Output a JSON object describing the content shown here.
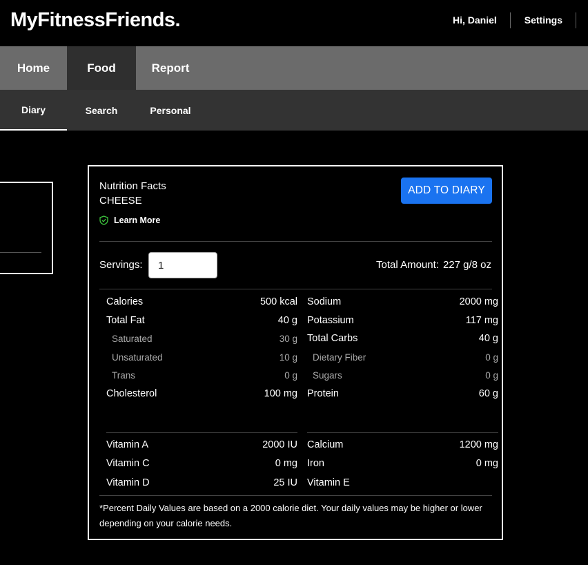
{
  "app": {
    "brand": "MyFitnessFriends.",
    "greeting": "Hi, Daniel",
    "settings_label": "Settings"
  },
  "main_nav": {
    "tabs": [
      {
        "label": "Home"
      },
      {
        "label": "Food"
      },
      {
        "label": "Report"
      }
    ],
    "active": "Food"
  },
  "sub_nav": {
    "tabs": [
      {
        "label": "Diary"
      },
      {
        "label": "Search"
      },
      {
        "label": "Personal"
      }
    ],
    "active": "Diary"
  },
  "nutrition": {
    "heading": "Nutrition Facts",
    "food_name": "CHEESE",
    "learn_more": "Learn More",
    "add_button": "ADD TO DIARY",
    "servings_label": "Servings:",
    "servings_value": "1",
    "total_label": "Total Amount:",
    "total_value": "227 g/8 oz",
    "left_rows": [
      {
        "label": "Calories",
        "value": "500 kcal"
      },
      {
        "label": "Total Fat",
        "value": "40 g"
      },
      {
        "label": "Saturated",
        "value": "30 g"
      },
      {
        "label": "Unsaturated",
        "value": "10 g"
      },
      {
        "label": "Trans",
        "value": "0 g"
      },
      {
        "label": "Cholesterol",
        "value": "100 mg"
      }
    ],
    "right_rows": [
      {
        "label": "Sodium",
        "value": "2000 mg"
      },
      {
        "label": "Potassium",
        "value": "117 mg"
      },
      {
        "label": "Total Carbs",
        "value": "40 g"
      },
      {
        "label": "Dietary Fiber",
        "value": "0 g"
      },
      {
        "label": "Sugars",
        "value": "0 g"
      },
      {
        "label": "Protein",
        "value": "60 g"
      }
    ],
    "vitamins_left": [
      {
        "label": "Vitamin A",
        "value": "2000 IU"
      },
      {
        "label": "Vitamin C",
        "value": "0 mg"
      },
      {
        "label": "Vitamin D",
        "value": "25 IU"
      }
    ],
    "vitamins_right": [
      {
        "label": "Calcium",
        "value": "1200 mg"
      },
      {
        "label": "Iron",
        "value": "0 mg"
      },
      {
        "label": "Vitamin E",
        "value": ""
      }
    ],
    "footnote": "*Percent Daily Values are based on a 2000 calorie diet. Your daily values may be higher or lower depending on your calorie needs."
  },
  "colors": {
    "accent": "#1a73f0",
    "nav_bg": "#6b6b6b",
    "subnav_bg": "#333333",
    "shield_icon": "#3cc43c"
  },
  "icons": {
    "learn_more": "shield-check-icon"
  }
}
